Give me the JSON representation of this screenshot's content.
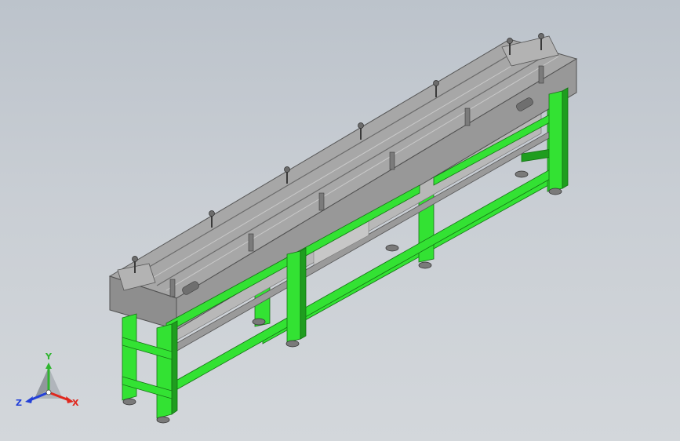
{
  "model": {
    "frame_color": "#33e233",
    "frame_shade": "#1f9d1f",
    "frame_dark": "#157015",
    "metal_light": "#a9a9a9",
    "metal_mid": "#8c8c8c",
    "metal_dark": "#5f5f5f",
    "foot_color": "#7a7a7a"
  },
  "triad": {
    "x_label": "X",
    "y_label": "Y",
    "z_label": "Z",
    "x_color": "#e0281e",
    "y_color": "#2fb52f",
    "z_color": "#2340d8"
  }
}
